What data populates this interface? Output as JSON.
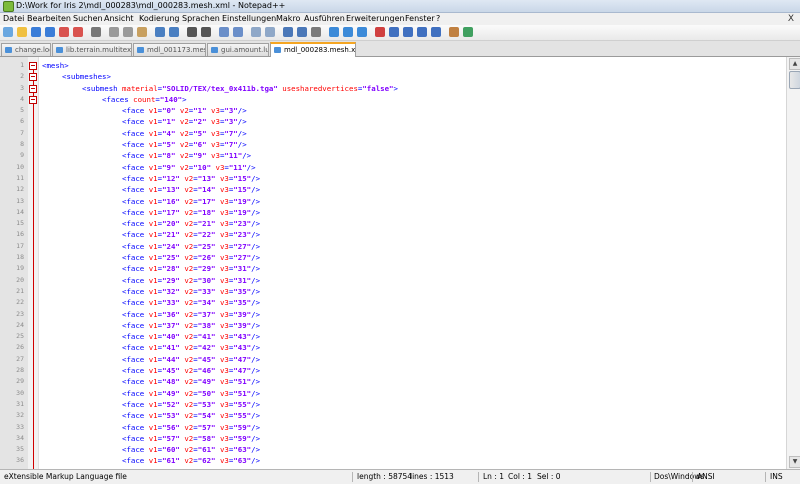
{
  "window": {
    "title": "D:\\Work for Iris 2\\mdl_000283\\mdl_000283.mesh.xml - Notepad++"
  },
  "menu": {
    "items": [
      "Datei",
      "Bearbeiten",
      "Suchen",
      "Ansicht",
      "Kodierung",
      "Sprachen",
      "Einstellungen",
      "Makro",
      "Ausführen",
      "Erweiterungen",
      "Fenster",
      "?"
    ],
    "close": "X"
  },
  "toolbar": {
    "icons": [
      "new-file-icon",
      "open-file-icon",
      "save-icon",
      "save-all-icon",
      "close-icon",
      "close-all-icon",
      "print-icon",
      "cut-icon",
      "copy-icon",
      "paste-icon",
      "undo-icon",
      "redo-icon",
      "find-icon",
      "replace-icon",
      "zoom-in-icon",
      "zoom-out-icon",
      "sync-v-icon",
      "sync-h-icon",
      "word-wrap-icon",
      "show-all-chars-icon",
      "indent-guide-icon",
      "bookmark-icon",
      "fold-icon",
      "unfold-icon",
      "macro-record-icon",
      "macro-stop-icon",
      "macro-play-icon",
      "macro-play-multiple-icon",
      "macro-save-icon",
      "plugin-icon",
      "spell-check-icon"
    ]
  },
  "tabs": [
    {
      "label": "change.log",
      "active": false
    },
    {
      "label": "lib.terrain.multitex.lua",
      "active": false
    },
    {
      "label": "mdl_001173.mesh",
      "active": false
    },
    {
      "label": "gui.amount.lua",
      "active": false
    },
    {
      "label": "mdl_000283.mesh.xml",
      "active": true
    }
  ],
  "editor": {
    "lines": [
      {
        "n": "1",
        "indent": 0,
        "fold": true,
        "tag": "mesh",
        "attrs": [],
        "close": ">"
      },
      {
        "n": "2",
        "indent": 1,
        "fold": true,
        "tag": "submeshes",
        "attrs": [],
        "close": ">"
      },
      {
        "n": "3",
        "indent": 2,
        "fold": true,
        "tag": "submesh",
        "attrs": [
          [
            "material",
            "SOLID/TEX/tex_0x411b.tga"
          ],
          [
            "usesharedvertices",
            "false"
          ]
        ],
        "close": ">"
      },
      {
        "n": "4",
        "indent": 3,
        "fold": true,
        "tag": "faces",
        "attrs": [
          [
            "count",
            "140"
          ]
        ],
        "close": ">"
      },
      {
        "n": "5",
        "indent": 4,
        "tag": "face",
        "attrs": [
          [
            "v1",
            "0"
          ],
          [
            "v2",
            "1"
          ],
          [
            "v3",
            "3"
          ]
        ],
        "close": "/>"
      },
      {
        "n": "6",
        "indent": 4,
        "tag": "face",
        "attrs": [
          [
            "v1",
            "1"
          ],
          [
            "v2",
            "2"
          ],
          [
            "v3",
            "3"
          ]
        ],
        "close": "/>"
      },
      {
        "n": "7",
        "indent": 4,
        "tag": "face",
        "attrs": [
          [
            "v1",
            "4"
          ],
          [
            "v2",
            "5"
          ],
          [
            "v3",
            "7"
          ]
        ],
        "close": "/>"
      },
      {
        "n": "8",
        "indent": 4,
        "tag": "face",
        "attrs": [
          [
            "v1",
            "5"
          ],
          [
            "v2",
            "6"
          ],
          [
            "v3",
            "7"
          ]
        ],
        "close": "/>"
      },
      {
        "n": "9",
        "indent": 4,
        "tag": "face",
        "attrs": [
          [
            "v1",
            "8"
          ],
          [
            "v2",
            "9"
          ],
          [
            "v3",
            "11"
          ]
        ],
        "close": "/>"
      },
      {
        "n": "10",
        "indent": 4,
        "tag": "face",
        "attrs": [
          [
            "v1",
            "9"
          ],
          [
            "v2",
            "10"
          ],
          [
            "v3",
            "11"
          ]
        ],
        "close": "/>"
      },
      {
        "n": "11",
        "indent": 4,
        "tag": "face",
        "attrs": [
          [
            "v1",
            "12"
          ],
          [
            "v2",
            "13"
          ],
          [
            "v3",
            "15"
          ]
        ],
        "close": "/>"
      },
      {
        "n": "12",
        "indent": 4,
        "tag": "face",
        "attrs": [
          [
            "v1",
            "13"
          ],
          [
            "v2",
            "14"
          ],
          [
            "v3",
            "15"
          ]
        ],
        "close": "/>"
      },
      {
        "n": "13",
        "indent": 4,
        "tag": "face",
        "attrs": [
          [
            "v1",
            "16"
          ],
          [
            "v2",
            "17"
          ],
          [
            "v3",
            "19"
          ]
        ],
        "close": "/>"
      },
      {
        "n": "14",
        "indent": 4,
        "tag": "face",
        "attrs": [
          [
            "v1",
            "17"
          ],
          [
            "v2",
            "18"
          ],
          [
            "v3",
            "19"
          ]
        ],
        "close": "/>"
      },
      {
        "n": "15",
        "indent": 4,
        "tag": "face",
        "attrs": [
          [
            "v1",
            "20"
          ],
          [
            "v2",
            "21"
          ],
          [
            "v3",
            "23"
          ]
        ],
        "close": "/>"
      },
      {
        "n": "16",
        "indent": 4,
        "tag": "face",
        "attrs": [
          [
            "v1",
            "21"
          ],
          [
            "v2",
            "22"
          ],
          [
            "v3",
            "23"
          ]
        ],
        "close": "/>"
      },
      {
        "n": "17",
        "indent": 4,
        "tag": "face",
        "attrs": [
          [
            "v1",
            "24"
          ],
          [
            "v2",
            "25"
          ],
          [
            "v3",
            "27"
          ]
        ],
        "close": "/>"
      },
      {
        "n": "18",
        "indent": 4,
        "tag": "face",
        "attrs": [
          [
            "v1",
            "25"
          ],
          [
            "v2",
            "26"
          ],
          [
            "v3",
            "27"
          ]
        ],
        "close": "/>"
      },
      {
        "n": "19",
        "indent": 4,
        "tag": "face",
        "attrs": [
          [
            "v1",
            "28"
          ],
          [
            "v2",
            "29"
          ],
          [
            "v3",
            "31"
          ]
        ],
        "close": "/>"
      },
      {
        "n": "20",
        "indent": 4,
        "tag": "face",
        "attrs": [
          [
            "v1",
            "29"
          ],
          [
            "v2",
            "30"
          ],
          [
            "v3",
            "31"
          ]
        ],
        "close": "/>"
      },
      {
        "n": "21",
        "indent": 4,
        "tag": "face",
        "attrs": [
          [
            "v1",
            "32"
          ],
          [
            "v2",
            "33"
          ],
          [
            "v3",
            "35"
          ]
        ],
        "close": "/>"
      },
      {
        "n": "22",
        "indent": 4,
        "tag": "face",
        "attrs": [
          [
            "v1",
            "33"
          ],
          [
            "v2",
            "34"
          ],
          [
            "v3",
            "35"
          ]
        ],
        "close": "/>"
      },
      {
        "n": "23",
        "indent": 4,
        "tag": "face",
        "attrs": [
          [
            "v1",
            "36"
          ],
          [
            "v2",
            "37"
          ],
          [
            "v3",
            "39"
          ]
        ],
        "close": "/>"
      },
      {
        "n": "24",
        "indent": 4,
        "tag": "face",
        "attrs": [
          [
            "v1",
            "37"
          ],
          [
            "v2",
            "38"
          ],
          [
            "v3",
            "39"
          ]
        ],
        "close": "/>"
      },
      {
        "n": "25",
        "indent": 4,
        "tag": "face",
        "attrs": [
          [
            "v1",
            "40"
          ],
          [
            "v2",
            "41"
          ],
          [
            "v3",
            "43"
          ]
        ],
        "close": "/>"
      },
      {
        "n": "26",
        "indent": 4,
        "tag": "face",
        "attrs": [
          [
            "v1",
            "41"
          ],
          [
            "v2",
            "42"
          ],
          [
            "v3",
            "43"
          ]
        ],
        "close": "/>"
      },
      {
        "n": "27",
        "indent": 4,
        "tag": "face",
        "attrs": [
          [
            "v1",
            "44"
          ],
          [
            "v2",
            "45"
          ],
          [
            "v3",
            "47"
          ]
        ],
        "close": "/>"
      },
      {
        "n": "28",
        "indent": 4,
        "tag": "face",
        "attrs": [
          [
            "v1",
            "45"
          ],
          [
            "v2",
            "46"
          ],
          [
            "v3",
            "47"
          ]
        ],
        "close": "/>"
      },
      {
        "n": "29",
        "indent": 4,
        "tag": "face",
        "attrs": [
          [
            "v1",
            "48"
          ],
          [
            "v2",
            "49"
          ],
          [
            "v3",
            "51"
          ]
        ],
        "close": "/>"
      },
      {
        "n": "30",
        "indent": 4,
        "tag": "face",
        "attrs": [
          [
            "v1",
            "49"
          ],
          [
            "v2",
            "50"
          ],
          [
            "v3",
            "51"
          ]
        ],
        "close": "/>"
      },
      {
        "n": "31",
        "indent": 4,
        "tag": "face",
        "attrs": [
          [
            "v1",
            "52"
          ],
          [
            "v2",
            "53"
          ],
          [
            "v3",
            "55"
          ]
        ],
        "close": "/>"
      },
      {
        "n": "32",
        "indent": 4,
        "tag": "face",
        "attrs": [
          [
            "v1",
            "53"
          ],
          [
            "v2",
            "54"
          ],
          [
            "v3",
            "55"
          ]
        ],
        "close": "/>"
      },
      {
        "n": "33",
        "indent": 4,
        "tag": "face",
        "attrs": [
          [
            "v1",
            "56"
          ],
          [
            "v2",
            "57"
          ],
          [
            "v3",
            "59"
          ]
        ],
        "close": "/>"
      },
      {
        "n": "34",
        "indent": 4,
        "tag": "face",
        "attrs": [
          [
            "v1",
            "57"
          ],
          [
            "v2",
            "58"
          ],
          [
            "v3",
            "59"
          ]
        ],
        "close": "/>"
      },
      {
        "n": "35",
        "indent": 4,
        "tag": "face",
        "attrs": [
          [
            "v1",
            "60"
          ],
          [
            "v2",
            "61"
          ],
          [
            "v3",
            "63"
          ]
        ],
        "close": "/>"
      },
      {
        "n": "36",
        "indent": 4,
        "tag": "face",
        "attrs": [
          [
            "v1",
            "61"
          ],
          [
            "v2",
            "62"
          ],
          [
            "v3",
            "63"
          ]
        ],
        "close": "/>"
      }
    ]
  },
  "status": {
    "file_type": "eXtensible Markup Language file",
    "length": "length : 58754",
    "lines": "lines : 1513",
    "ln": "Ln : 1",
    "col": "Col : 1",
    "sel": "Sel : 0",
    "eol": "Dos\\Windows",
    "encoding": "ANSI",
    "mode": "INS"
  },
  "colors": {
    "tag": "#0000ff",
    "attr": "#ff0000",
    "value": "#8000ff",
    "fold": "#d00000",
    "active_tab_accent": "#f5a623"
  }
}
